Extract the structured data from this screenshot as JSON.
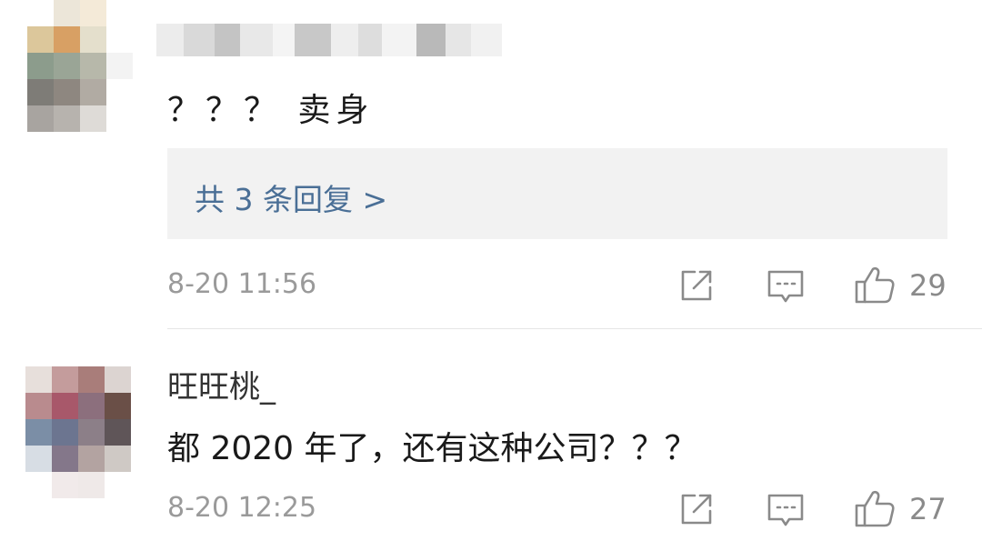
{
  "comments": [
    {
      "text": "？？？ 卖身",
      "reply_link": "共 3 条回复 >",
      "time": "8-20 11:56",
      "like_count": "29",
      "avatar_colors": [
        "#ffffff",
        "#ece6d9",
        "#f4ead8",
        "#ffffff",
        "#dcc79b",
        "#d8a064",
        "#e4dfcc",
        "#ffffff",
        "#8c9c8c",
        "#9aa596",
        "#b7b8aa",
        "#f3f3f3",
        "#7e7c77",
        "#8e8780",
        "#b1aba3",
        "#ffffff",
        "#a8a4a0",
        "#b7b3ae",
        "#dedbd7",
        "#ffffff"
      ]
    },
    {
      "username": "旺旺桃_",
      "text": "都 2020 年了，还有这种公司？？？",
      "time": "8-20 12:25",
      "like_count": "27",
      "avatar_colors": [
        "#e7dfdb",
        "#c49c9c",
        "#a97d7a",
        "#dcd4d1",
        "#b98b8e",
        "#a8586a",
        "#8c6f7d",
        "#6a4f47",
        "#7b8ea6",
        "#6c7590",
        "#8c7f88",
        "#5f5558",
        "#d7dde4",
        "#84778a",
        "#b3a3a1",
        "#cfc9c5",
        "#ffffff",
        "#f1eaea",
        "#efe9e8",
        "#ffffff"
      ]
    }
  ],
  "blurred_name_colors": [
    "#ececec",
    "#d9d9d9",
    "#c4c4c4",
    "#e8e8e8",
    "#f4f4f4",
    "#c8c8c8",
    "#eeeeee",
    "#dddddd",
    "#f3f3f3",
    "#b9b9b9",
    "#e6e6e6",
    "#f1f1f1"
  ]
}
